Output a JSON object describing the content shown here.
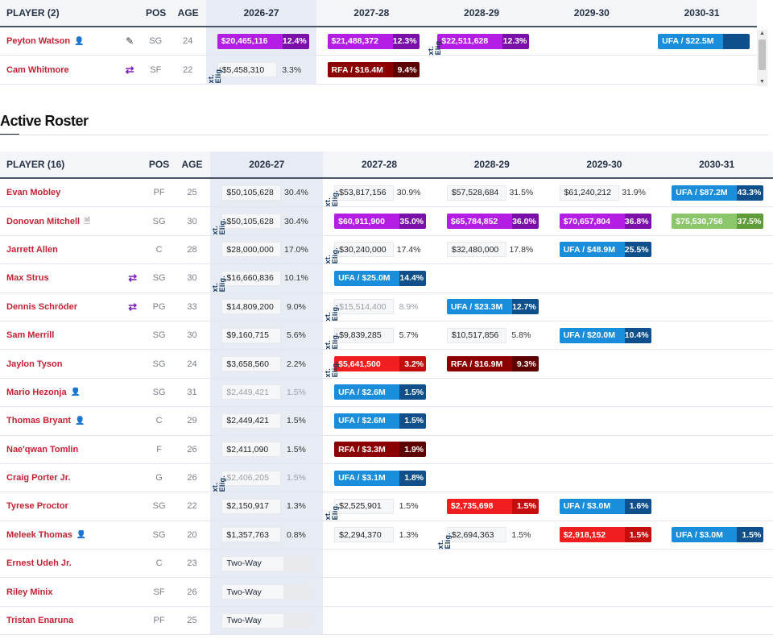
{
  "top_table": {
    "header": {
      "player": "PLAYER (2)",
      "pos": "POS",
      "age": "AGE",
      "seasons": [
        "2026-27",
        "2027-28",
        "2028-29",
        "2029-30",
        "2030-31"
      ]
    },
    "rows": [
      {
        "name": "Peyton Watson",
        "icon": "person-tag-icon",
        "mark": "edit-icon",
        "pos": "SG",
        "age": "24",
        "cells": [
          {
            "style": "purple",
            "amt": "$20,465,116",
            "pct": "12.4%"
          },
          {
            "style": "purple",
            "amt": "$21,488,372",
            "pct": "12.3%"
          },
          {
            "style": "purple",
            "amt": "$22,511,628",
            "pct": "12.3%",
            "xe": "xt. Elig."
          },
          {
            "style": "empty"
          },
          {
            "style": "ufa",
            "amt": "UFA / $22.5M",
            "pct": ""
          }
        ]
      },
      {
        "name": "Cam Whitmore",
        "icon": "",
        "mark": "trade-icon",
        "pos": "SF",
        "age": "22",
        "cells": [
          {
            "style": "plain",
            "amt": "$5,458,310",
            "pct": "3.3%",
            "xe": "xt. Elig."
          },
          {
            "style": "rfa",
            "amt": "RFA / $16.4M",
            "pct": "9.4%"
          },
          {
            "style": "empty"
          },
          {
            "style": "empty"
          },
          {
            "style": "empty"
          }
        ]
      }
    ]
  },
  "section_title": "Active Roster",
  "roster_table": {
    "header": {
      "player": "PLAYER (16)",
      "pos": "POS",
      "age": "AGE",
      "seasons": [
        "2026-27",
        "2027-28",
        "2028-29",
        "2029-30",
        "2030-31"
      ]
    },
    "rows": [
      {
        "name": "Evan Mobley",
        "icon": "",
        "mark": "",
        "pos": "PF",
        "age": "25",
        "cells": [
          {
            "style": "plain",
            "amt": "$50,105,628",
            "pct": "30.4%"
          },
          {
            "style": "plain",
            "amt": "$53,817,156",
            "pct": "30.9%",
            "xe": "xt. Elig."
          },
          {
            "style": "plain",
            "amt": "$57,528,684",
            "pct": "31.5%"
          },
          {
            "style": "plain",
            "amt": "$61,240,212",
            "pct": "31.9%"
          },
          {
            "style": "ufa",
            "amt": "UFA / $87.2M",
            "pct": "43.3%"
          }
        ]
      },
      {
        "name": "Donovan Mitchell",
        "icon": "doc-icon",
        "mark": "",
        "pos": "SG",
        "age": "30",
        "cells": [
          {
            "style": "plain",
            "amt": "$50,105,628",
            "pct": "30.4%",
            "xe": "xt. Elig."
          },
          {
            "style": "purple",
            "amt": "$60,911,900",
            "pct": "35.0%"
          },
          {
            "style": "purple",
            "amt": "$65,784,852",
            "pct": "36.0%"
          },
          {
            "style": "purple",
            "amt": "$70,657,804",
            "pct": "36.8%"
          },
          {
            "style": "green",
            "amt": "$75,530,756",
            "pct": "37.5%"
          }
        ]
      },
      {
        "name": "Jarrett Allen",
        "icon": "",
        "mark": "",
        "pos": "C",
        "age": "28",
        "cells": [
          {
            "style": "plain",
            "amt": "$28,000,000",
            "pct": "17.0%"
          },
          {
            "style": "plain",
            "amt": "$30,240,000",
            "pct": "17.4%",
            "xe": "xt. Elig."
          },
          {
            "style": "plain",
            "amt": "$32,480,000",
            "pct": "17.8%"
          },
          {
            "style": "ufa",
            "amt": "UFA / $48.9M",
            "pct": "25.5%"
          },
          {
            "style": "empty"
          }
        ]
      },
      {
        "name": "Max Strus",
        "icon": "",
        "mark": "trade-icon",
        "pos": "SG",
        "age": "30",
        "cells": [
          {
            "style": "plain",
            "amt": "$16,660,836",
            "pct": "10.1%",
            "xe": "xt. Elig."
          },
          {
            "style": "ufa",
            "amt": "UFA / $25.0M",
            "pct": "14.4%"
          },
          {
            "style": "empty"
          },
          {
            "style": "empty"
          },
          {
            "style": "empty"
          }
        ]
      },
      {
        "name": "Dennis Schröder",
        "icon": "",
        "mark": "trade-icon",
        "pos": "PG",
        "age": "33",
        "cells": [
          {
            "style": "plain",
            "amt": "$14,809,200",
            "pct": "9.0%"
          },
          {
            "style": "muted",
            "amt": "$15,514,400",
            "pct": "8.9%",
            "xe": "xt. Elig."
          },
          {
            "style": "ufa",
            "amt": "UFA / $23.3M",
            "pct": "12.7%"
          },
          {
            "style": "empty"
          },
          {
            "style": "empty"
          }
        ]
      },
      {
        "name": "Sam Merrill",
        "icon": "",
        "mark": "",
        "pos": "SG",
        "age": "30",
        "cells": [
          {
            "style": "plain",
            "amt": "$9,160,715",
            "pct": "5.6%"
          },
          {
            "style": "plain",
            "amt": "$9,839,285",
            "pct": "5.7%",
            "xe": "xt. Elig."
          },
          {
            "style": "plain",
            "amt": "$10,517,856",
            "pct": "5.8%"
          },
          {
            "style": "ufa",
            "amt": "UFA / $20.0M",
            "pct": "10.4%"
          },
          {
            "style": "empty"
          }
        ]
      },
      {
        "name": "Jaylon Tyson",
        "icon": "",
        "mark": "",
        "pos": "SG",
        "age": "24",
        "cells": [
          {
            "style": "plain",
            "amt": "$3,658,560",
            "pct": "2.2%"
          },
          {
            "style": "red",
            "amt": "$5,641,500",
            "pct": "3.2%",
            "xe": "xt. Elig."
          },
          {
            "style": "rfa",
            "amt": "RFA / $16.9M",
            "pct": "9.3%"
          },
          {
            "style": "empty"
          },
          {
            "style": "empty"
          }
        ]
      },
      {
        "name": "Mario Hezonja",
        "icon": "person-tag-icon",
        "mark": "",
        "pos": "SG",
        "age": "31",
        "cells": [
          {
            "style": "muted",
            "amt": "$2,449,421",
            "pct": "1.5%"
          },
          {
            "style": "ufa",
            "amt": "UFA / $2.6M",
            "pct": "1.5%"
          },
          {
            "style": "empty"
          },
          {
            "style": "empty"
          },
          {
            "style": "empty"
          }
        ]
      },
      {
        "name": "Thomas Bryant",
        "icon": "person-tag-icon",
        "mark": "",
        "pos": "C",
        "age": "29",
        "cells": [
          {
            "style": "plain",
            "amt": "$2,449,421",
            "pct": "1.5%"
          },
          {
            "style": "ufa",
            "amt": "UFA / $2.6M",
            "pct": "1.5%"
          },
          {
            "style": "empty"
          },
          {
            "style": "empty"
          },
          {
            "style": "empty"
          }
        ]
      },
      {
        "name": "Nae'qwan Tomlin",
        "icon": "",
        "mark": "",
        "pos": "F",
        "age": "26",
        "cells": [
          {
            "style": "plain",
            "amt": "$2,411,090",
            "pct": "1.5%"
          },
          {
            "style": "rfa",
            "amt": "RFA / $3.3M",
            "pct": "1.9%"
          },
          {
            "style": "empty"
          },
          {
            "style": "empty"
          },
          {
            "style": "empty"
          }
        ]
      },
      {
        "name": "Craig Porter Jr.",
        "icon": "",
        "mark": "",
        "pos": "G",
        "age": "26",
        "cells": [
          {
            "style": "muted",
            "amt": "$2,406,205",
            "pct": "1.5%",
            "xe": "xt. Elig."
          },
          {
            "style": "ufa",
            "amt": "UFA / $3.1M",
            "pct": "1.8%"
          },
          {
            "style": "empty"
          },
          {
            "style": "empty"
          },
          {
            "style": "empty"
          }
        ]
      },
      {
        "name": "Tyrese Proctor",
        "icon": "",
        "mark": "",
        "pos": "SG",
        "age": "22",
        "cells": [
          {
            "style": "plain",
            "amt": "$2,150,917",
            "pct": "1.3%"
          },
          {
            "style": "plain",
            "amt": "$2,525,901",
            "pct": "1.5%",
            "xe": "xt. Elig."
          },
          {
            "style": "red",
            "amt": "$2,735,698",
            "pct": "1.5%"
          },
          {
            "style": "ufa",
            "amt": "UFA / $3.0M",
            "pct": "1.6%"
          },
          {
            "style": "empty"
          }
        ]
      },
      {
        "name": "Meleek Thomas",
        "icon": "person-tag-icon",
        "mark": "",
        "pos": "SG",
        "age": "20",
        "cells": [
          {
            "style": "plain",
            "amt": "$1,357,763",
            "pct": "0.8%"
          },
          {
            "style": "plain",
            "amt": "$2,294,370",
            "pct": "1.3%"
          },
          {
            "style": "plain",
            "amt": "$2,694,363",
            "pct": "1.5%",
            "xe": "xt. Elig."
          },
          {
            "style": "red",
            "amt": "$2,918,152",
            "pct": "1.5%"
          },
          {
            "style": "ufa",
            "amt": "UFA / $3.0M",
            "pct": "1.5%"
          }
        ]
      },
      {
        "name": "Ernest Udeh Jr.",
        "icon": "",
        "mark": "",
        "pos": "C",
        "age": "23",
        "cells": [
          {
            "style": "twoway",
            "amt": "Two-Way"
          },
          {
            "style": "empty"
          },
          {
            "style": "empty"
          },
          {
            "style": "empty"
          },
          {
            "style": "empty"
          }
        ]
      },
      {
        "name": "Riley Minix",
        "icon": "",
        "mark": "",
        "pos": "SF",
        "age": "26",
        "cells": [
          {
            "style": "twoway",
            "amt": "Two-Way"
          },
          {
            "style": "empty"
          },
          {
            "style": "empty"
          },
          {
            "style": "empty"
          },
          {
            "style": "empty"
          }
        ]
      },
      {
        "name": "Tristan Enaruna",
        "icon": "",
        "mark": "",
        "pos": "PF",
        "age": "25",
        "cells": [
          {
            "style": "twoway",
            "amt": "Two-Way"
          },
          {
            "style": "empty"
          },
          {
            "style": "empty"
          },
          {
            "style": "empty"
          },
          {
            "style": "empty"
          }
        ]
      }
    ]
  },
  "colors": {
    "purple": "#b41ee4",
    "ufa": "#1a8ddb",
    "rfa": "#8b0000",
    "red": "#f01e1e",
    "green": "#8cc66a",
    "name": "#c42234"
  }
}
